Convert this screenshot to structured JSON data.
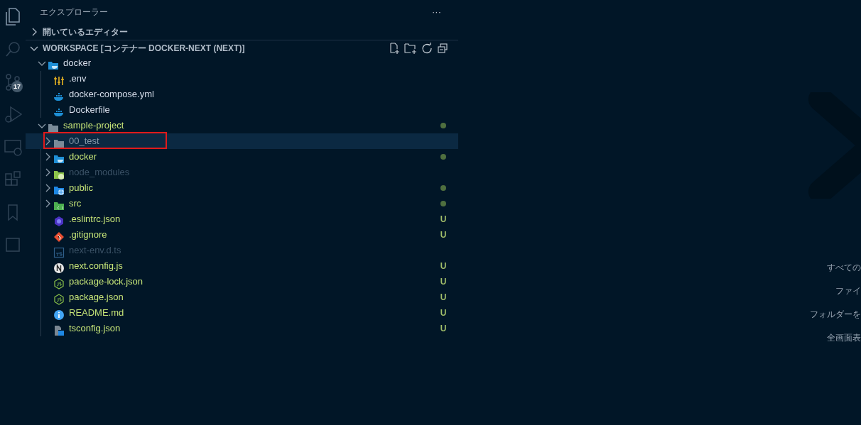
{
  "activity_bar": {
    "items": [
      {
        "kind": "files",
        "selected": true
      },
      {
        "kind": "search",
        "selected": false
      },
      {
        "kind": "scm",
        "selected": false,
        "badge": "17"
      },
      {
        "kind": "debug",
        "selected": false
      },
      {
        "kind": "remote",
        "selected": false
      },
      {
        "kind": "extensions",
        "selected": false
      },
      {
        "kind": "bookmark",
        "selected": false
      },
      {
        "kind": "square",
        "selected": false
      }
    ]
  },
  "sidebar": {
    "title": "エクスプローラー",
    "more": "···",
    "sections": [
      {
        "title": "開いているエディター",
        "expanded": false
      },
      {
        "title": "WORKSPACE [コンテナー DOCKER-NEXT (NEXT)]",
        "expanded": true
      }
    ],
    "tree": [
      {
        "name": "docker",
        "kind": "folder-docker",
        "expanded": true,
        "color": "#d6deeb",
        "modified_dot": false,
        "selected": false,
        "boxed": false,
        "children": [
          {
            "name": ".env",
            "kind": "env",
            "color": "#d6deeb",
            "modified_dot": false,
            "selected": false,
            "boxed": false
          },
          {
            "name": "docker-compose.yml",
            "kind": "docker",
            "color": "#d6deeb",
            "modified_dot": false,
            "selected": false,
            "boxed": false
          },
          {
            "name": "Dockerfile",
            "kind": "docker",
            "color": "#d6deeb",
            "modified_dot": false,
            "selected": false,
            "boxed": false
          }
        ]
      },
      {
        "name": "sample-project",
        "kind": "folder-plain",
        "expanded": true,
        "color": "#c5e478",
        "modified_dot": true,
        "selected": false,
        "boxed": false,
        "children": [
          {
            "name": "00_test",
            "kind": "folder-plain",
            "expanded": false,
            "color": "#8597a8",
            "modified_dot": false,
            "selected": true,
            "boxed": true
          },
          {
            "name": "docker",
            "kind": "folder-docker",
            "expanded": false,
            "color": "#c5e478",
            "modified_dot": true,
            "selected": false,
            "boxed": false
          },
          {
            "name": "node_modules",
            "kind": "folder-node",
            "expanded": false,
            "color": "#3b5266",
            "modified_dot": false,
            "selected": false,
            "boxed": false
          },
          {
            "name": "public",
            "kind": "folder-public",
            "expanded": false,
            "color": "#c5e478",
            "modified_dot": true,
            "selected": false,
            "boxed": false
          },
          {
            "name": "src",
            "kind": "folder-src",
            "expanded": false,
            "color": "#c5e478",
            "modified_dot": true,
            "selected": false,
            "boxed": false
          },
          {
            "name": ".eslintrc.json",
            "kind": "eslint",
            "color": "#c5e478",
            "modified_dot": false,
            "status": "U",
            "selected": false,
            "boxed": false
          },
          {
            "name": ".gitignore",
            "kind": "git",
            "color": "#c5e478",
            "modified_dot": false,
            "status": "U",
            "selected": false,
            "boxed": false
          },
          {
            "name": "next-env.d.ts",
            "kind": "ts",
            "color": "#3b5266",
            "modified_dot": false,
            "selected": false,
            "boxed": false
          },
          {
            "name": "next.config.js",
            "kind": "next",
            "color": "#c5e478",
            "modified_dot": false,
            "status": "U",
            "selected": false,
            "boxed": false
          },
          {
            "name": "package-lock.json",
            "kind": "node",
            "color": "#c5e478",
            "modified_dot": false,
            "status": "U",
            "selected": false,
            "boxed": false
          },
          {
            "name": "package.json",
            "kind": "node",
            "color": "#c5e478",
            "modified_dot": false,
            "status": "U",
            "selected": false,
            "boxed": false
          },
          {
            "name": "README.md",
            "kind": "info",
            "color": "#c5e478",
            "modified_dot": false,
            "status": "U",
            "selected": false,
            "boxed": false
          },
          {
            "name": "tsconfig.json",
            "kind": "tsconfig",
            "color": "#c5e478",
            "modified_dot": false,
            "status": "U",
            "selected": false,
            "boxed": false
          }
        ]
      }
    ]
  },
  "editor": {
    "hints": [
      "すべての",
      "ファイ",
      "フォルダーを",
      "全画面表"
    ]
  }
}
